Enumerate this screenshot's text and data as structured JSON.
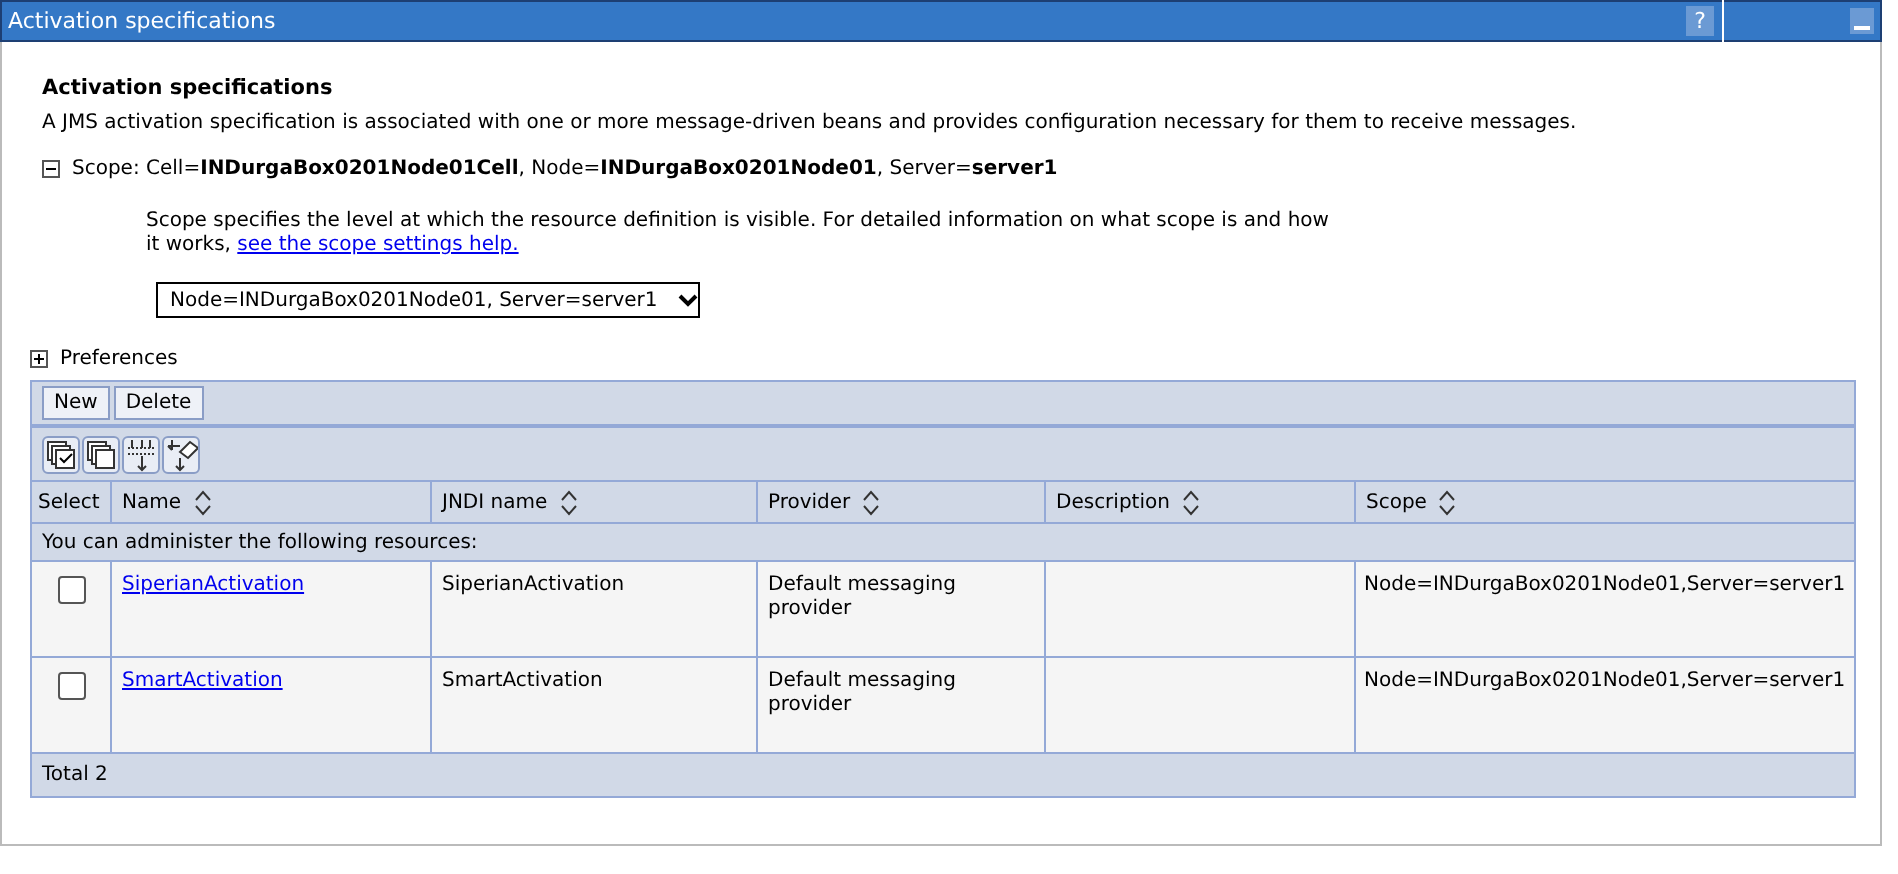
{
  "window": {
    "title": "Activation specifications",
    "help_button": "?"
  },
  "heading": "Activation specifications",
  "description": "A JMS activation specification is associated with one or more message-driven beans and provides configuration necessary for them to receive messages.",
  "scope": {
    "expanded": true,
    "label": "Scope: Cell=**INDurgaBox0201Node01Cell**, Node=**INDurgaBox0201Node01**, Server=**server1**",
    "help_text": "Scope specifies the level at which the resource definition is visible. For detailed information on what scope is and how it works,",
    "help_link": "see the scope settings help.",
    "selected_scope": "Node=INDurgaBox0201Node01, Server=server1"
  },
  "preferences": {
    "expanded": false,
    "label": "Preferences"
  },
  "buttons": [
    "New",
    "Delete"
  ],
  "toolbar": [
    {
      "kind": "select_all"
    },
    {
      "kind": "deselect_all"
    },
    {
      "kind": "show_filter"
    },
    {
      "kind": "clear_filter"
    }
  ],
  "table": {
    "columns": [
      "Select",
      "Name",
      "JNDI name",
      "Provider",
      "Description",
      "Scope"
    ],
    "info": "You can administer the following resources:",
    "rows": [
      {
        "checked": false,
        "name": "SiperianActivation",
        "jndi_name": "SiperianActivation",
        "provider": "Default messaging provider",
        "scope": "Node=INDurgaBox0201Node01,Server=server1"
      },
      {
        "checked": false,
        "name": "SmartActivation",
        "jndi_name": "SmartActivation",
        "provider": "Default messaging provider",
        "scope": "Node=INDurgaBox0201Node01,Server=server1"
      }
    ],
    "total": "Total 2"
  }
}
